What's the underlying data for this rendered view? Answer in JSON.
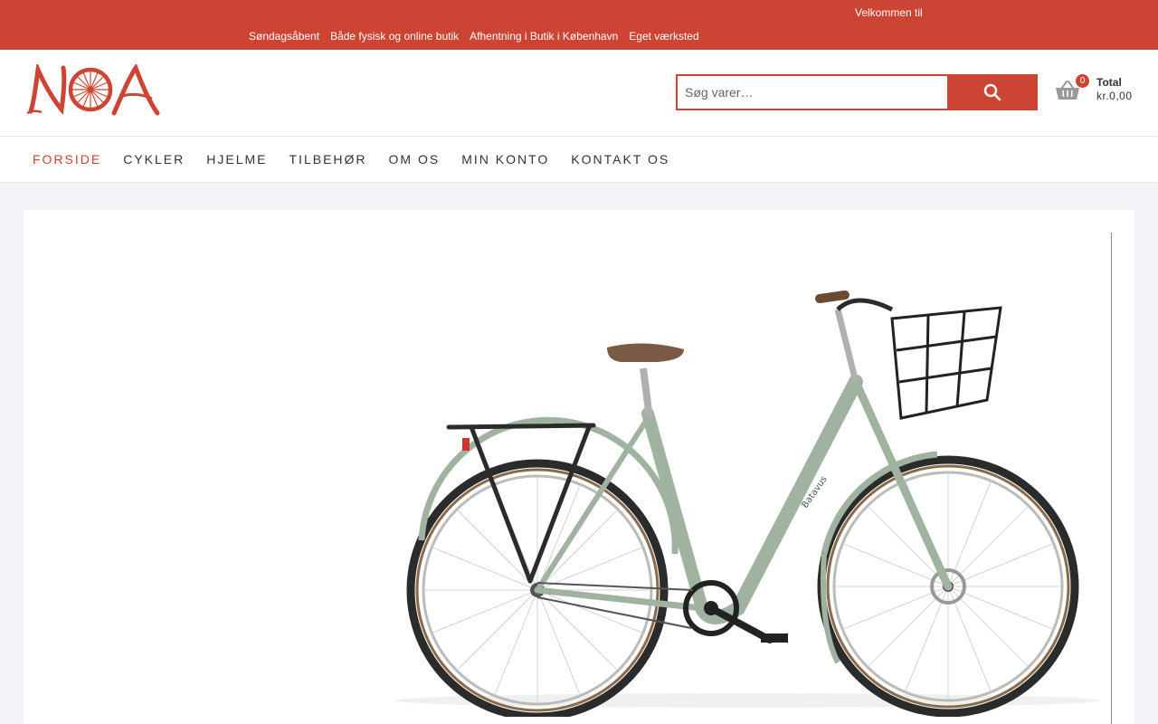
{
  "topbar": {
    "welcome": "Velkommen til",
    "usps": [
      "Søndagsåbent",
      "Både fysisk og online butik",
      "Afhentning i Butik i København",
      "Eget værksted"
    ]
  },
  "header": {
    "logo_text": "NOA",
    "search": {
      "placeholder": "Søg varer…",
      "value": ""
    },
    "cart": {
      "count": "0",
      "total_label": "Total",
      "total_value": "kr.0,00"
    }
  },
  "nav": {
    "items": [
      "FORSIDE",
      "CYKLER",
      "HJELME",
      "TILBEHØR",
      "OM OS",
      "MIN KONTO",
      "KONTAKT OS"
    ],
    "active": "FORSIDE"
  },
  "hero": {
    "image": "city-bicycle-with-front-basket",
    "frame_label": "Batavus"
  },
  "colors": {
    "brand": "#cc4433",
    "background": "#f2f3f6",
    "bike_frame": "#9fb3a0"
  }
}
